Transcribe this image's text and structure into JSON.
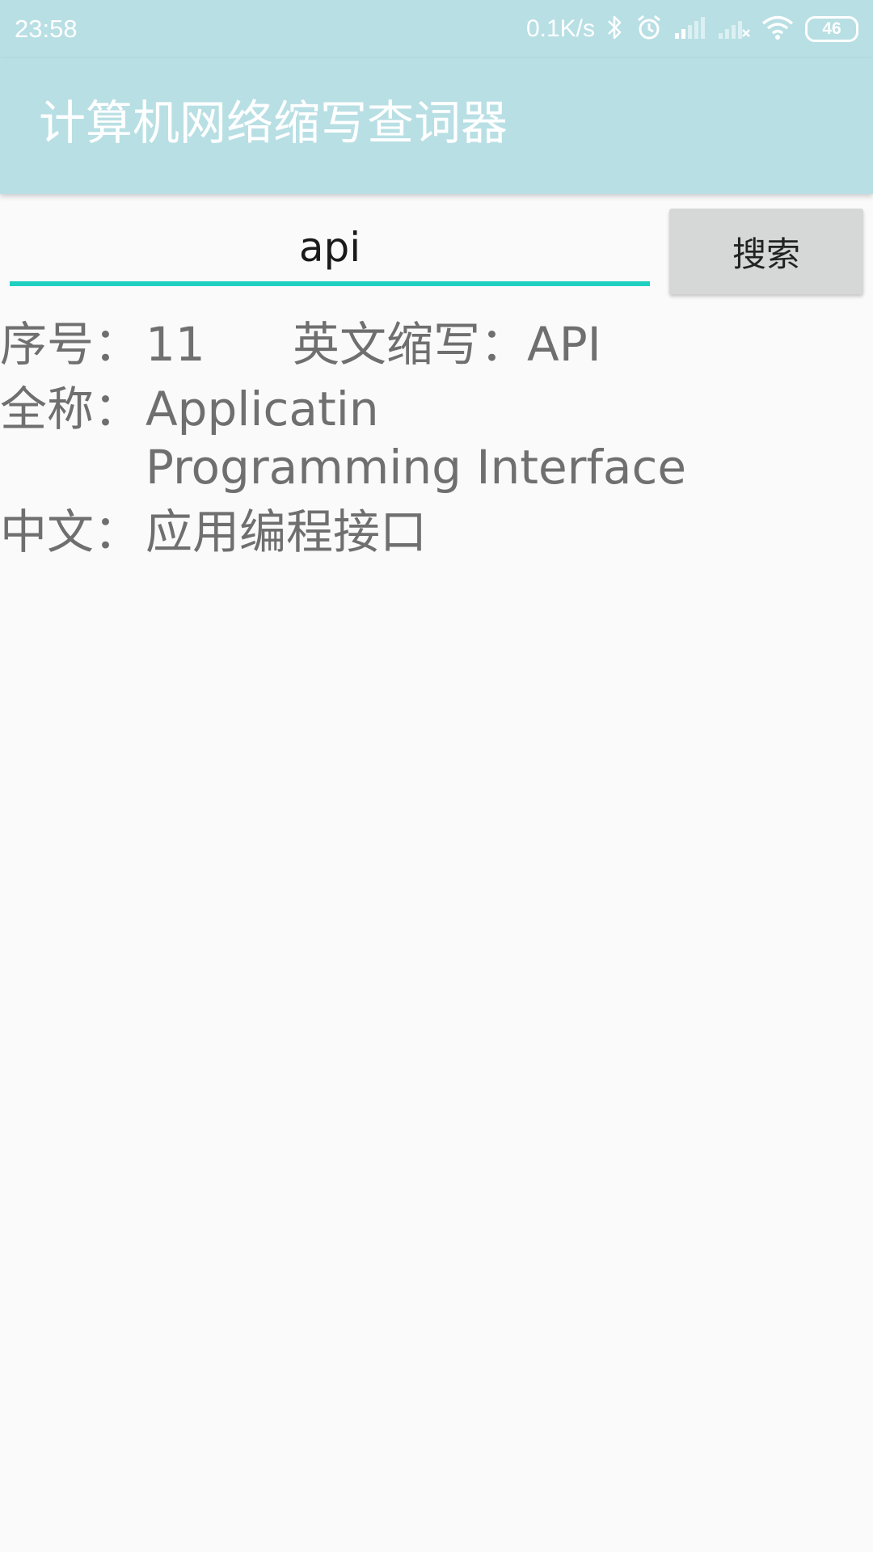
{
  "status_bar": {
    "time": "23:58",
    "net_speed": "0.1K/s",
    "battery": "46",
    "icons": [
      "bluetooth-icon",
      "alarm-icon",
      "signal-icon",
      "signal-off-icon",
      "wifi-icon",
      "battery-icon"
    ]
  },
  "app_bar": {
    "title": "计算机网络缩写查词器"
  },
  "search": {
    "value": "api",
    "button_label": "搜索",
    "accent": "#1fd0c0"
  },
  "result": {
    "id_label": "序号：",
    "id_value": "11",
    "abbr_label": "英文缩写：",
    "abbr_value": "API",
    "full_label": "全称：",
    "full_value": "Applicatin Programming Interface",
    "cn_label": "中文：",
    "cn_value": "应用编程接口"
  },
  "colors": {
    "app_bar": "#b8dfe4",
    "background": "#fafafa",
    "result_text": "#6f6f6f"
  }
}
